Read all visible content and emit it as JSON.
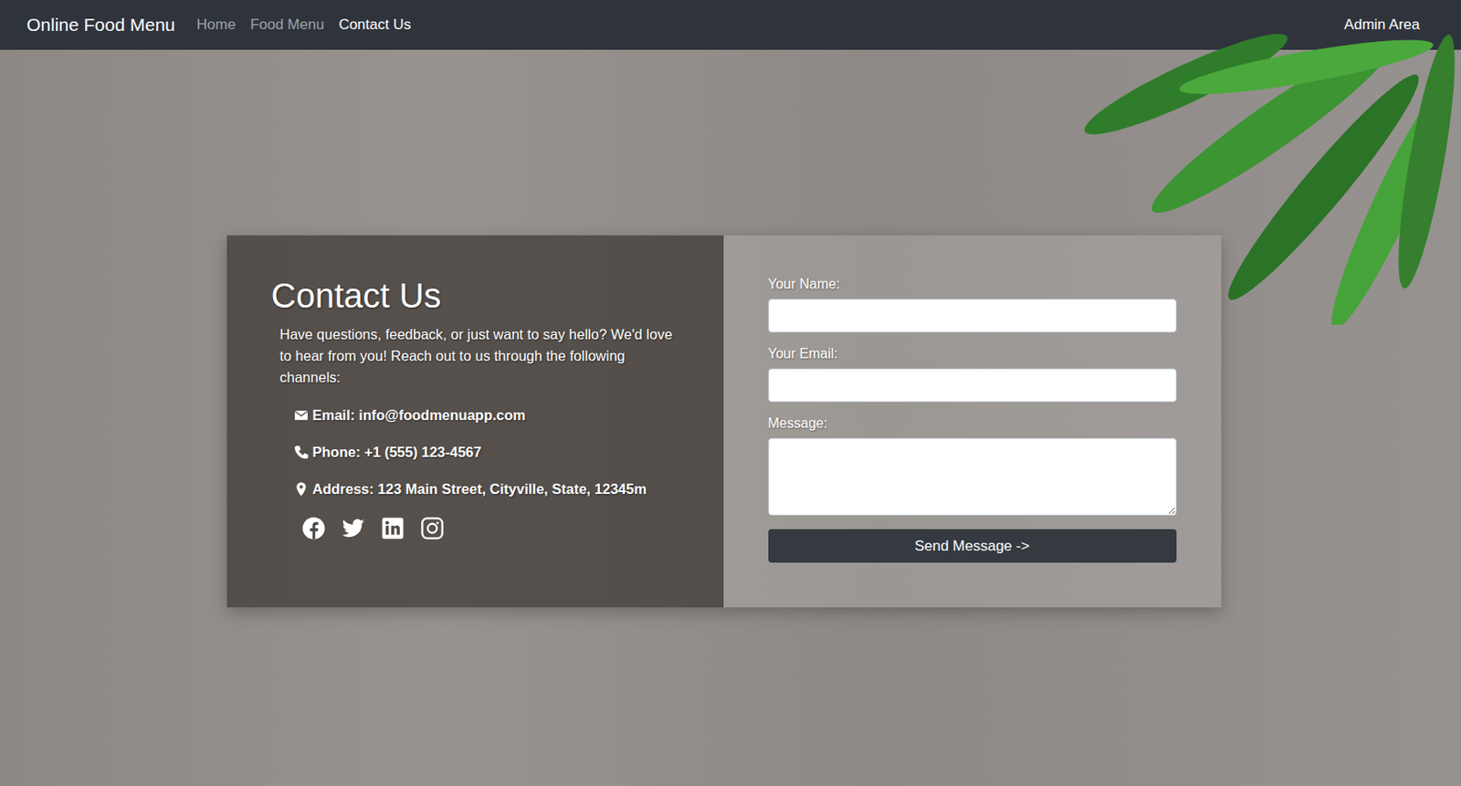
{
  "navbar": {
    "brand": "Online Food Menu",
    "links": [
      {
        "label": "Home",
        "selected": false
      },
      {
        "label": "Food Menu",
        "selected": false
      },
      {
        "label": "Contact Us",
        "selected": true
      }
    ],
    "admin": "Admin Area"
  },
  "contact": {
    "title": "Contact Us",
    "intro": "Have questions, feedback, or just want to say hello? We'd love to hear from you! Reach out to us through the following channels:",
    "items": [
      {
        "kind": "email",
        "text": "Email: info@foodmenuapp.com"
      },
      {
        "kind": "phone",
        "text": "Phone: +1 (555) 123-4567"
      },
      {
        "kind": "address",
        "text": "Address: 123 Main Street, Cityville, State, 12345m"
      }
    ]
  },
  "form": {
    "fields": [
      {
        "kind": "input",
        "label": "Your Name:",
        "value": ""
      },
      {
        "kind": "input",
        "label": "Your Email:",
        "value": ""
      },
      {
        "kind": "textarea",
        "label": "Message:",
        "value": ""
      }
    ],
    "button": "Send Message ->"
  }
}
